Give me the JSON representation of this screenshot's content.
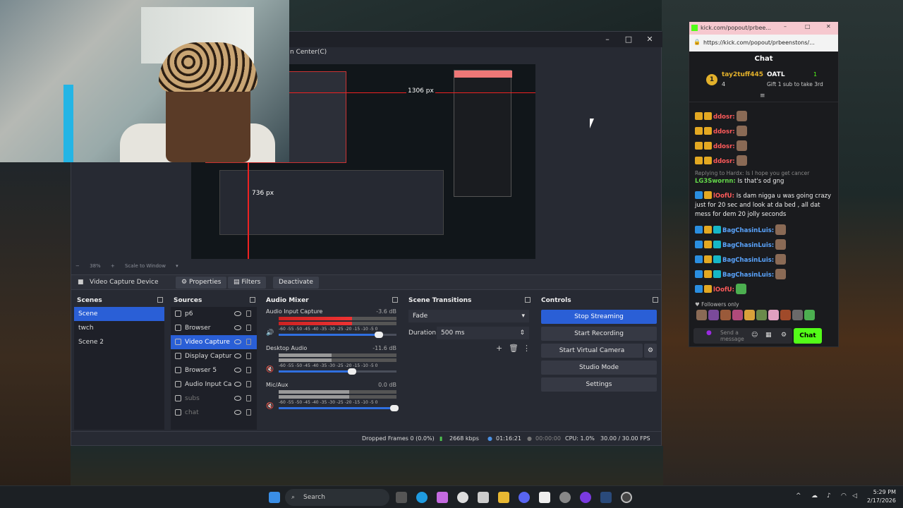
{
  "obs": {
    "menu_fragment": "n Center(C)",
    "preview_dim_1": "1306 px",
    "preview_dim_2": "736 px",
    "zoom": [
      "38%",
      "Scale to Window"
    ],
    "context": {
      "source_label": "Video Capture Device",
      "properties": "Properties",
      "filters": "Filters",
      "deactivate": "Deactivate"
    },
    "scenes": {
      "title": "Scenes",
      "items": [
        "Scene",
        "twch",
        "Scene 2"
      ]
    },
    "sources": {
      "title": "Sources",
      "items": [
        "p6",
        "Browser",
        "Video Capture",
        "Display Captur",
        "Browser 5",
        "Audio Input Ca",
        "subs",
        "chat"
      ]
    },
    "mixer": {
      "title": "Audio Mixer",
      "channels": [
        {
          "name": "Audio Input Capture",
          "db": "-3.6 dB",
          "level": 0.62,
          "volume": 0.85
        },
        {
          "name": "Desktop Audio",
          "db": "-11.6 dB",
          "level": 0.45,
          "volume": 0.62
        },
        {
          "name": "Mic/Aux",
          "db": "0.0 dB",
          "level": 0.6,
          "volume": 0.98
        }
      ],
      "ticks": "-60 -55 -50 -45 -40 -35 -30 -25 -20 -15 -10 -5 0"
    },
    "transitions": {
      "title": "Scene Transitions",
      "selected": "Fade",
      "duration_label": "Duration",
      "duration_value": "500 ms"
    },
    "controls": {
      "title": "Controls",
      "stop_streaming": "Stop Streaming",
      "start_recording": "Start Recording",
      "start_virtual_camera": "Start Virtual Camera",
      "studio_mode": "Studio Mode",
      "settings": "Settings"
    },
    "status": {
      "dropped_frames": "Dropped Frames 0 (0.0%)",
      "bitrate": "2668 kbps",
      "stream_time": "01:16:21",
      "rec_time": "00:00:00",
      "cpu": "CPU: 1.0%",
      "fps": "30.00 / 30.00 FPS"
    }
  },
  "kick": {
    "tab_title": "kick.com/popout/prbee...",
    "url": "https://kick.com/popout/prbeenstons/...",
    "header": "Chat",
    "pinned": {
      "user": "tay2tuff445",
      "count": "4",
      "rank": "1",
      "gifter": "OATL",
      "gifter_count": "1",
      "gift_text": "Gift 1 sub to take 3rd"
    },
    "messages": [
      {
        "user": "ddosr:",
        "text": ""
      },
      {
        "user": "ddosr:",
        "text": ""
      },
      {
        "user": "ddosr:",
        "text": ""
      },
      {
        "user": "ddosr:",
        "text": ""
      },
      {
        "reply": "Replying to Hardx: Is I hope you get cancer",
        "user": "LG3Swornn:",
        "text": "Is that's od gng"
      },
      {
        "user": "lOofU:",
        "text": "Is dam nigga u was going crazy just for 20 sec and look at da bed , all dat mess for dem 20 jolly seconds"
      },
      {
        "user": "BagChasinLuis:",
        "text": ""
      },
      {
        "user": "BagChasinLuis:",
        "text": ""
      },
      {
        "user": "BagChasinLuis:",
        "text": ""
      },
      {
        "user": "BagChasinLuis:",
        "text": ""
      },
      {
        "user": "lOofU:",
        "text": ""
      }
    ],
    "followers_only": "Followers only",
    "input_placeholder": "Send a message",
    "chat_button": "Chat"
  },
  "taskbar": {
    "search": "Search",
    "time": "5:29 PM",
    "date": "2/17/2026"
  }
}
